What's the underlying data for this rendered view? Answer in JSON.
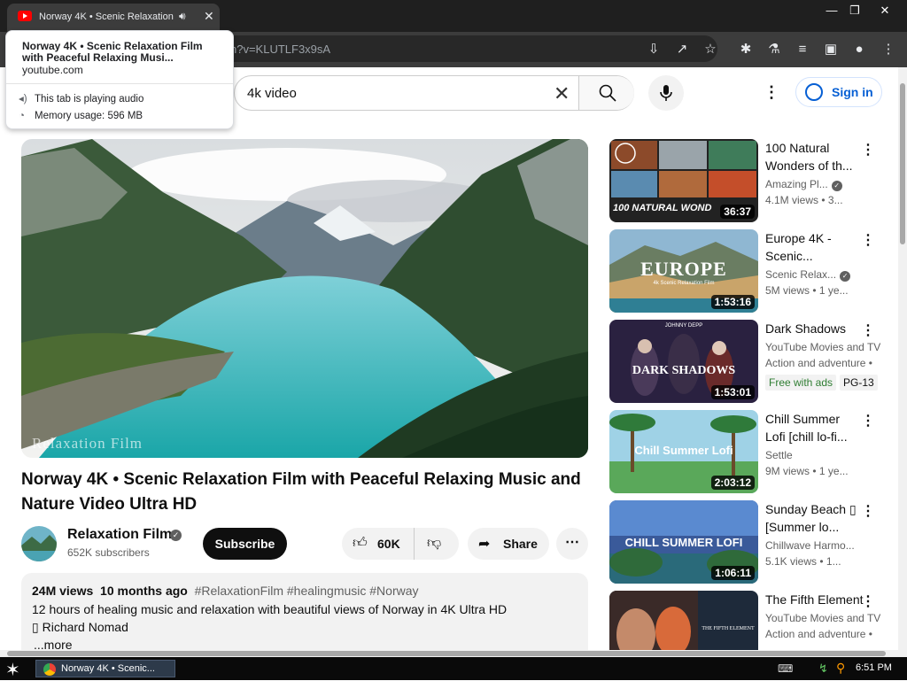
{
  "browser": {
    "tab_title": "Norway 4K • Scenic Relaxation",
    "url_fragment": "n?v=KLUTLF3x9sA",
    "minimize": "—",
    "restore": "❐",
    "close": "✕"
  },
  "hover_card": {
    "title": "Norway 4K • Scenic Relaxation Film with Peaceful Relaxing Musi...",
    "domain": "youtube.com",
    "audio_note": "This tab is playing audio",
    "memory": "Memory usage: 596 MB"
  },
  "search": {
    "query": "4k video"
  },
  "header": {
    "sign_in": "Sign in"
  },
  "video": {
    "watermark": "Relaxation Film",
    "title": "Norway 4K • Scenic Relaxation Film with Peaceful Relaxing Music and Nature Video Ultra HD",
    "channel": "Relaxation Film",
    "subscribers": "652K subscribers",
    "subscribe_label": "Subscribe",
    "likes": "60K",
    "share_label": "Share"
  },
  "description": {
    "views": "24M views",
    "age": "10 months ago",
    "tags": "#RelaxationFilm #healingmusic #Norway",
    "line1": "12 hours of healing music and relaxation with beautiful views of Norway in 4K Ultra HD",
    "line2": "▯ Richard Nomad",
    "more": "...more"
  },
  "recommendations": [
    {
      "title": "100 Natural Wonders of th...",
      "channel": "Amazing Pl...",
      "verified": true,
      "views": "4.1M views",
      "age": "• 3...",
      "duration": "36:37",
      "thumb_text": "100 NATURAL WOND"
    },
    {
      "title": "Europe 4K - Scenic...",
      "channel": "Scenic Relax...",
      "verified": true,
      "views": "5M views",
      "age": "• 1 ye...",
      "duration": "1:53:16",
      "thumb_text": "EUROPE",
      "thumb_sub": "4k Scenic Relaxation Film"
    },
    {
      "title": "Dark Shadows",
      "channel": "YouTube Movies and TV",
      "verified": false,
      "views": "Action and adventure •",
      "age": "",
      "duration": "1:53:01",
      "thumb_text": "DARK SHADOWS",
      "thumb_top": "JOHNNY DEPP",
      "badges": [
        "Free with ads",
        "PG-13"
      ]
    },
    {
      "title": "Chill Summer Lofi [chill lo-fi...",
      "channel": "Settle",
      "verified": false,
      "views": "9M views",
      "age": "• 1 ye...",
      "duration": "2:03:12",
      "thumb_text": "Chill Summer Lofi"
    },
    {
      "title": "Sunday Beach ▯ [Summer lo...",
      "channel": "Chillwave Harmo...",
      "verified": false,
      "views": "5.1K views",
      "age": "• 1...",
      "duration": "1:06:11",
      "thumb_text": "CHILL SUMMER LOFI"
    },
    {
      "title": "The Fifth Element",
      "channel": "YouTube Movies and TV",
      "verified": false,
      "views": "Action and adventure •",
      "age": "",
      "duration": "",
      "thumb_text": "THE FIFTH ELEMENT"
    }
  ],
  "taskbar": {
    "task_label": "Norway 4K • Scenic...",
    "keyboard": "⌨",
    "clock": "6:51 PM"
  }
}
